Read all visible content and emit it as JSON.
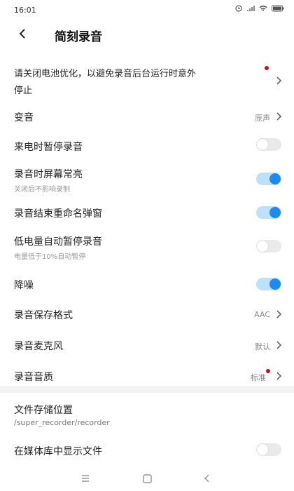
{
  "status_bar": {
    "time": "16:01",
    "icons": [
      "alarm-icon",
      "signal-icon",
      "wifi-icon",
      "battery-icon"
    ]
  },
  "header": {
    "title": "简刻录音"
  },
  "settings": {
    "battery": {
      "label": "请关闭电池优化，以避免录音后台运行时意外",
      "label2": "停止"
    },
    "voice_change": {
      "label": "变音",
      "value": "原声"
    },
    "pause_on_call": {
      "label": "来电时暂停录音",
      "enabled": false
    },
    "screen_on": {
      "label": "录音时屏幕常亮",
      "sub": "关闭后不影响录制",
      "enabled": true
    },
    "rename_popup": {
      "label": "录音结束重命名弹窗",
      "enabled": true
    },
    "low_battery": {
      "label": "低电量自动暂停录音",
      "sub": "电量低于10%自动暂停",
      "enabled": false
    },
    "noise_reduction": {
      "label": "降噪",
      "enabled": true
    },
    "format": {
      "label": "录音保存格式",
      "value": "AAC"
    },
    "microphone": {
      "label": "录音麦克风",
      "value": "默认"
    },
    "quality": {
      "label": "录音音质",
      "value": "标准"
    },
    "storage": {
      "label": "文件存储位置",
      "path": "/super_recorder/recorder"
    },
    "show_in_media": {
      "label": "在媒体库中显示文件",
      "enabled": false
    }
  },
  "colors": {
    "accent": "#1e8af0",
    "badge": "#c0141f"
  }
}
